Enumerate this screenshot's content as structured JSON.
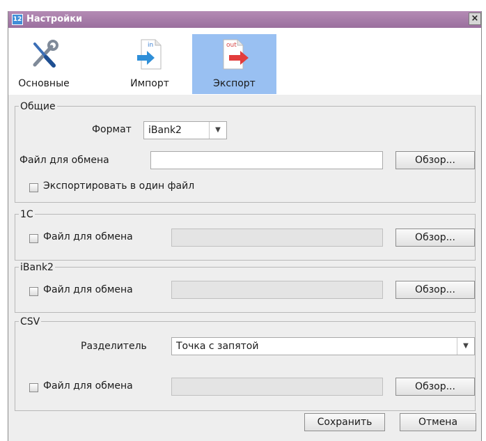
{
  "window": {
    "title": "Настройки",
    "app_icon": "12",
    "close": "×"
  },
  "tabs": [
    {
      "label": "Основные",
      "icon": "wrench-screwdriver-icon"
    },
    {
      "label": "Импорт",
      "icon": "import-in-icon"
    },
    {
      "label": "Экспорт",
      "icon": "export-out-icon",
      "active": true
    }
  ],
  "icon_text": {
    "in": "in",
    "out": "out"
  },
  "general": {
    "legend": "Общие",
    "format_label": "Формат",
    "format_value": "iBank2",
    "file_label": "Файл для обмена",
    "file_value": "",
    "browse": "Обзор...",
    "one_file_label": "Экспортировать в один файл"
  },
  "onec": {
    "legend": "1С",
    "file_label": "Файл для обмена",
    "file_value": "",
    "browse": "Обзор..."
  },
  "ibank2": {
    "legend": "iBank2",
    "file_label": "Файл для обмена",
    "file_value": "",
    "browse": "Обзор..."
  },
  "csv": {
    "legend": "CSV",
    "separator_label": "Разделитель",
    "separator_value": "Точка с запятой",
    "file_label": "Файл для обмена",
    "file_value": "",
    "browse": "Обзор..."
  },
  "footer": {
    "save": "Сохранить",
    "cancel": "Отмена"
  },
  "colors": {
    "title_bar": "#9a6f9e",
    "active_tab": "#99c0f2",
    "window_bg": "#eeeeee"
  }
}
